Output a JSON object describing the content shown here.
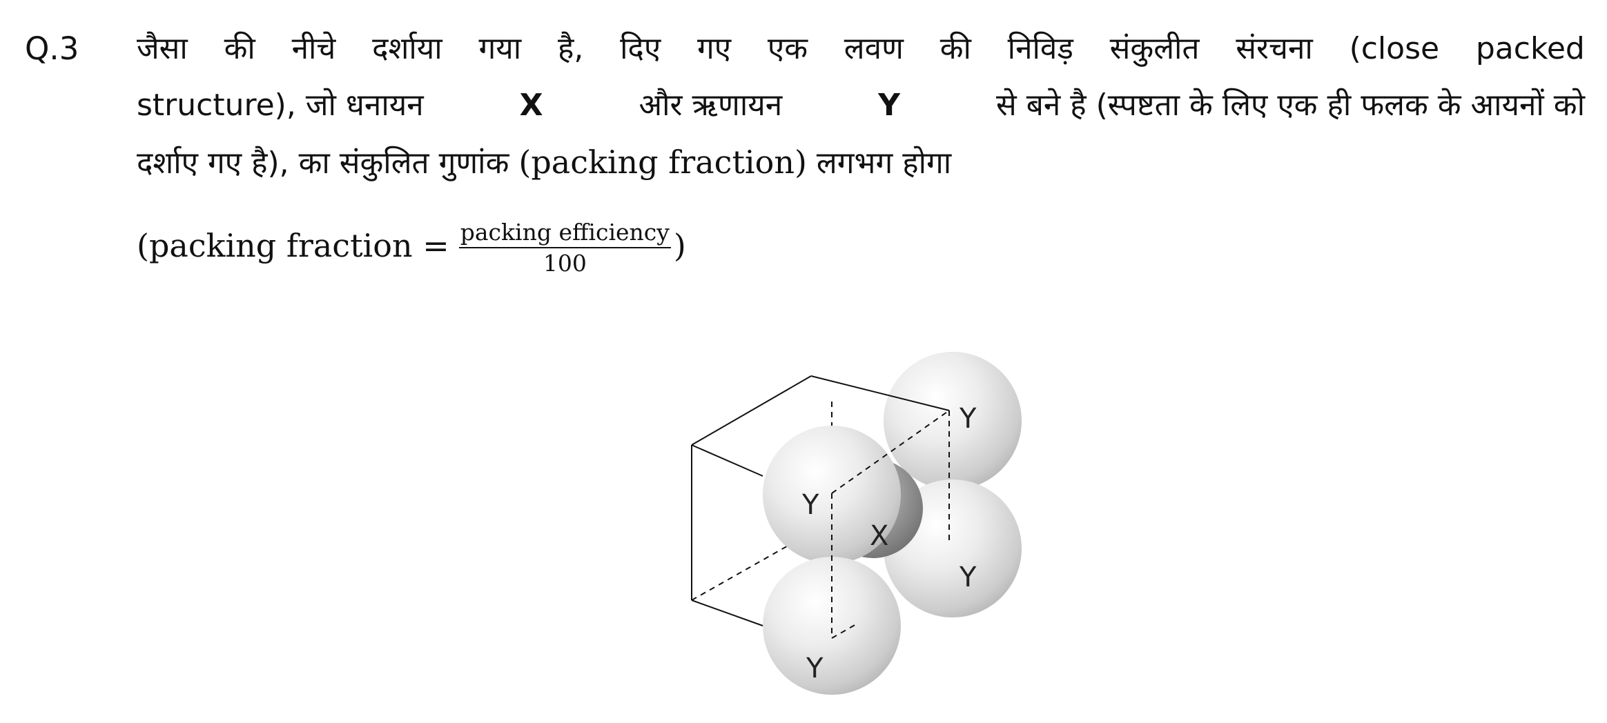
{
  "question": {
    "number": "Q.3",
    "line1_words": [
      "जैसा",
      "की",
      "नीचे",
      "दर्शाया",
      "गया",
      "है,",
      "दिए",
      "गए",
      "एक",
      "लवण",
      "की",
      "निविड़",
      "संकुलीत",
      "संरचना",
      "(close",
      "packed"
    ],
    "line2_a": "structure), जो धनायन",
    "cation": "X",
    "line2_b": "और ऋणायन",
    "anion": "Y",
    "line2_c": "से बने है (स्पष्टता के लिए एक ही फलक के आयनों को",
    "line3_a": "दर्शाए गए है), का संकुलित गुणांक",
    "line3_b": "(packing fraction)",
    "line3_c": "लगभग होगा",
    "formula_lhs": "(packing fraction  =",
    "formula_num": "packing efficiency",
    "formula_den": "100",
    "formula_close": ")"
  },
  "figure": {
    "labels": {
      "y_top_right": "Y",
      "y_front": "Y",
      "x_center": "X",
      "y_right": "Y",
      "y_bottom": "Y"
    }
  }
}
